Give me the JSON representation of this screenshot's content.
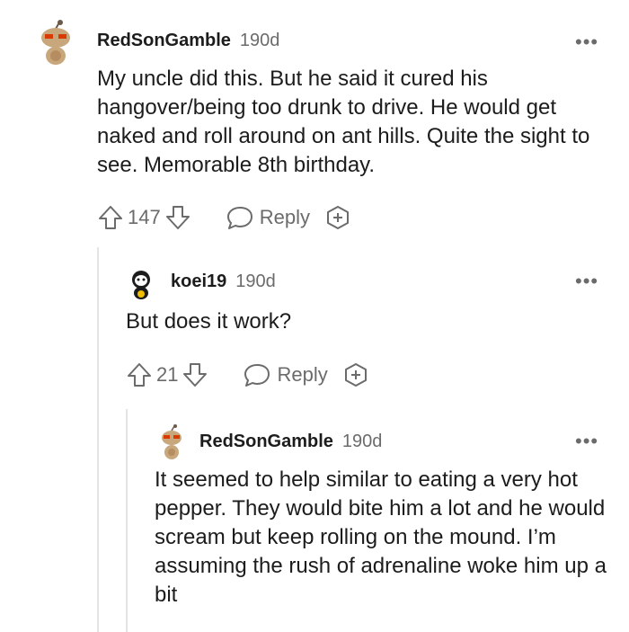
{
  "comments": [
    {
      "username": "RedSonGamble",
      "age": "190d",
      "more": "•••",
      "text": "My uncle did this. But he said it cured his hangover/being too drunk to drive. He would get naked and roll around on ant hills. Quite the sight to see. Memorable 8th birthday.",
      "votes": "147",
      "reply_label": "Reply",
      "avatar_icon": "snoo-avatar-icon"
    },
    {
      "username": "koei19",
      "age": "190d",
      "more": "•••",
      "text": "But does it work?",
      "votes": "21",
      "reply_label": "Reply",
      "avatar_icon": "snoo-avatar-icon"
    },
    {
      "username": "RedSonGamble",
      "age": "190d",
      "more": "•••",
      "text": "It seemed to help similar to eating a very hot pepper. They would bite him a lot and he would scream but keep rolling on the mound. I’m assuming the rush of adrenaline woke him up a bit",
      "avatar_icon": "snoo-avatar-icon"
    }
  ],
  "colors": {
    "text": "#1c1c1c",
    "muted": "#6b6b6b",
    "thread_line": "#e4e4e4"
  }
}
